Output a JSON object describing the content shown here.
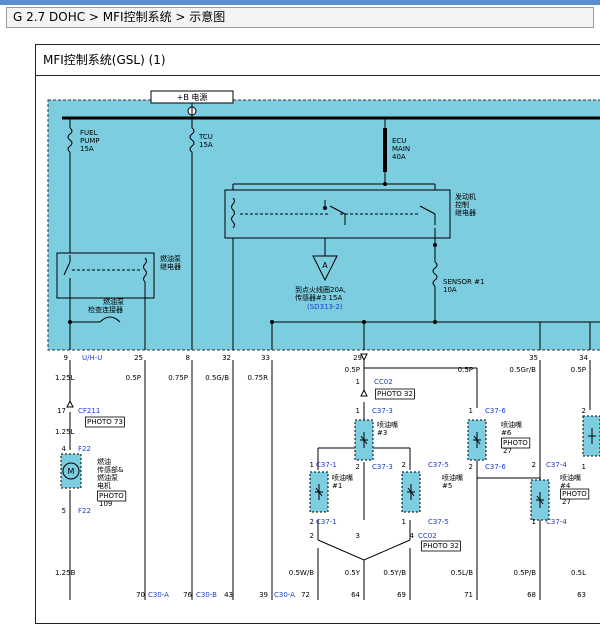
{
  "breadcrumb": {
    "text": "G 2.7 DOHC > MFI控制系统 > 示意图"
  },
  "diagram": {
    "title": "MFI控制系统(GSL) (1)",
    "power_label": "+B 电源",
    "fuses": {
      "fuel_pump": [
        "FUEL",
        "PUMP",
        "15A"
      ],
      "tcu": [
        "TCU",
        "15A"
      ],
      "ecu_main": [
        "ECU",
        "MAIN",
        "40A"
      ],
      "sensor1": [
        "SENSOR #1",
        "10A"
      ]
    },
    "engine_relay": [
      "发动机",
      "控制",
      "继电器"
    ],
    "fuel_pump_relay": [
      "燃油泵",
      "继电器"
    ],
    "check_connector": [
      "燃油泵",
      "检查连接器"
    ],
    "ref_note": [
      "到点火线圈20A,",
      "传感器#3 15A"
    ],
    "ref_code": "(SD313-2)",
    "triangle_label": "A",
    "pins": [
      {
        "num": "9",
        "name": "U/H-U"
      },
      {
        "num": "25",
        "name": ""
      },
      {
        "num": "8",
        "name": ""
      },
      {
        "num": "32",
        "name": ""
      },
      {
        "num": "33",
        "name": ""
      },
      {
        "num": "29",
        "name": ""
      },
      {
        "num": "35",
        "name": ""
      },
      {
        "num": "34",
        "name": ""
      }
    ],
    "wire_labels": {
      "w125L": "1.25L",
      "w05P_a": "0.5P",
      "w075P": "0.75P",
      "w05GB": "0.5G/B",
      "w075R": "0.75R",
      "w05P_b": "0.5P",
      "w05P_c": "0.5P",
      "w05GrB": "0.5Gr/B",
      "w05P_d": "0.5P",
      "w125L_b": "1.25L",
      "w125B": "1.25B",
      "w05WB": "0.5W/B",
      "w05Y": "0.5Y",
      "w05YB": "0.5Y/B",
      "w05LB": "0.5L/B",
      "w05PB": "0.5P/B",
      "w05L": "0.5L"
    },
    "connectors": {
      "cf211": "CF211",
      "photo73": "PHOTO 73",
      "f22": "F22",
      "f22b": "F22",
      "cc02": "CC02",
      "photo32": "PHOTO 32",
      "cc02b": "CC02",
      "photo32b": "PHOTO 32",
      "c373": "C37-3",
      "c373b": "C37-3",
      "c376": "C37-6",
      "c376b": "C37-6",
      "c371": "C37-1",
      "c371b": "C37-1",
      "c375": "C37-5",
      "c375b": "C37-5",
      "c374": "C37-4",
      "c374b": "C37-4",
      "c30a_1": "C30-A",
      "c30b": "C30-B",
      "c30a_2": "C30-A"
    },
    "components": {
      "motor": [
        "燃油",
        "传感部&",
        "燃油泵",
        "电机"
      ],
      "motor_photo": [
        "PHOTO",
        "109"
      ],
      "inj3": [
        "喷油嘴",
        "#3"
      ],
      "inj6": [
        "喷油嘴",
        "#6"
      ],
      "inj6_photo": [
        "PHOTO",
        "27"
      ],
      "inj1": [
        "喷油嘴",
        "#1"
      ],
      "inj5": [
        "喷油嘴",
        "#5"
      ],
      "inj4": [
        "喷油嘴",
        "#4"
      ],
      "inj4_photo": [
        "PHOTO",
        "27"
      ]
    },
    "bottom_pins": [
      "70",
      "76",
      "43",
      "39",
      "72",
      "64",
      "69",
      "71",
      "68",
      "63"
    ],
    "small_nums": [
      "17",
      "1",
      "4",
      "5",
      "1",
      "1",
      "2",
      "1",
      "2",
      "1",
      "2",
      "2",
      "1",
      "2",
      "2",
      "1",
      "2",
      "1",
      "2",
      "3",
      "4",
      "M"
    ]
  },
  "colors": {
    "panel": "#7ccde0",
    "wire": "#000000",
    "accent_blue": "#1a3fd0",
    "header": "#5a8fd0"
  }
}
